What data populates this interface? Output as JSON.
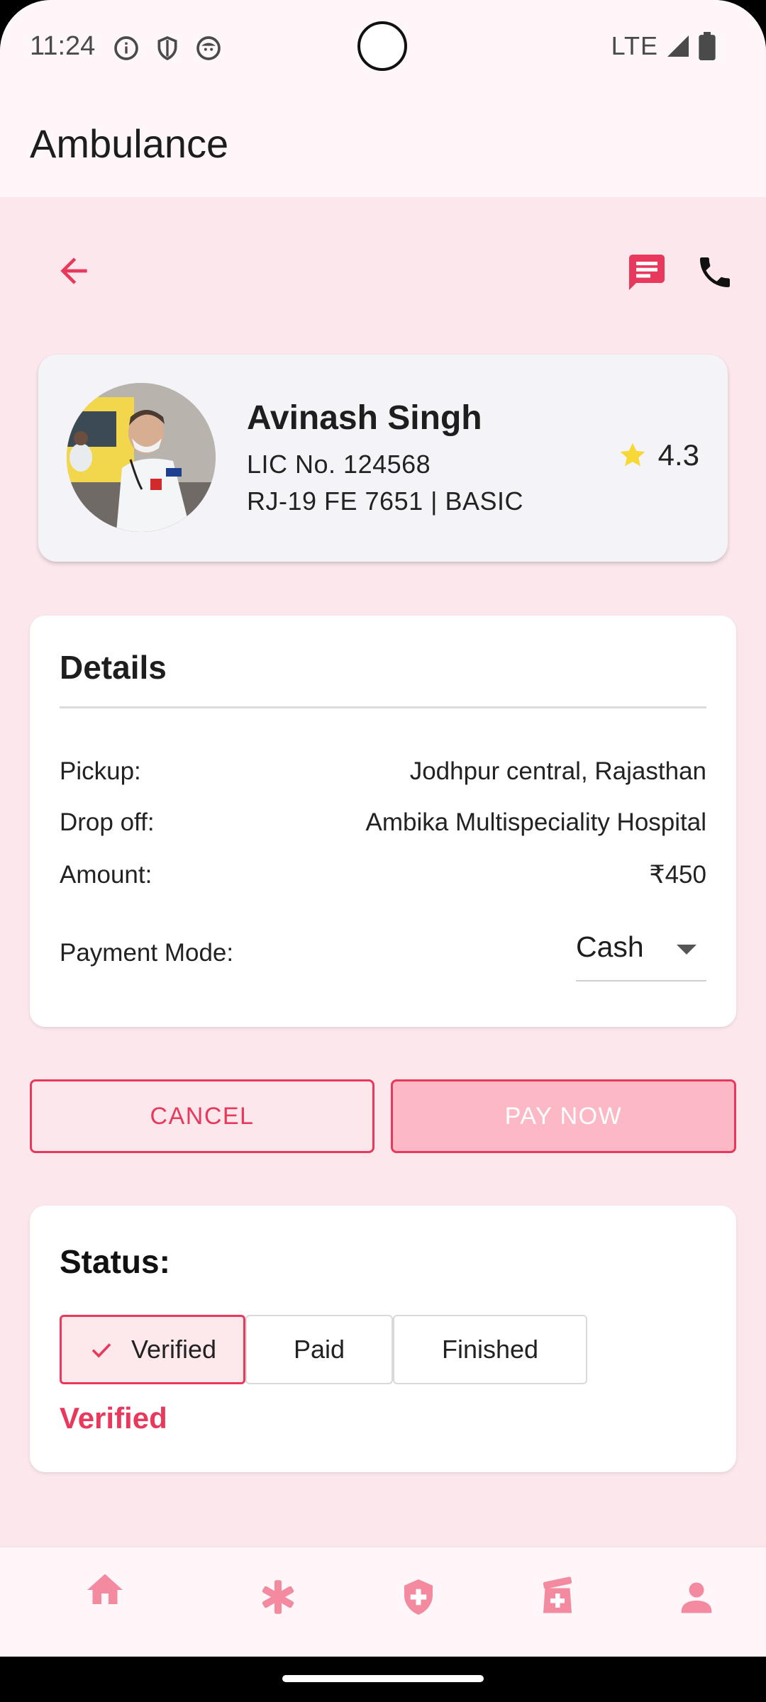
{
  "status_bar": {
    "time": "11:24",
    "network": "LTE"
  },
  "app_bar": {
    "title": "Ambulance"
  },
  "driver": {
    "name": "Avinash Singh",
    "license": "LIC No. 124568",
    "vehicle": "RJ-19 FE 7651 | BASIC",
    "rating": "4.3"
  },
  "details": {
    "title": "Details",
    "rows": [
      {
        "label": "Pickup:",
        "value": "Jodhpur central, Rajasthan"
      },
      {
        "label": "Drop off:",
        "value": "Ambika Multispeciality Hospital"
      },
      {
        "label": "Amount:",
        "value": "₹450"
      }
    ],
    "payment_label": "Payment Mode:",
    "payment_value": "Cash"
  },
  "actions": {
    "cancel_label": "CANCEL",
    "pay_label": "PAY NOW"
  },
  "status": {
    "title": "Status:",
    "steps": [
      {
        "label": "Verified",
        "selected": true
      },
      {
        "label": "Paid",
        "selected": false
      },
      {
        "label": "Finished",
        "selected": false
      }
    ],
    "current": "Verified"
  },
  "colors": {
    "accent": "#e8395c",
    "accent_light": "#fcb8c4",
    "background": "#fce8ec",
    "star": "#f6d837"
  },
  "bottom_nav": {
    "items": [
      "home-icon",
      "medical-asterisk-icon",
      "shield-plus-icon",
      "medicine-bottle-icon",
      "person-icon"
    ]
  }
}
